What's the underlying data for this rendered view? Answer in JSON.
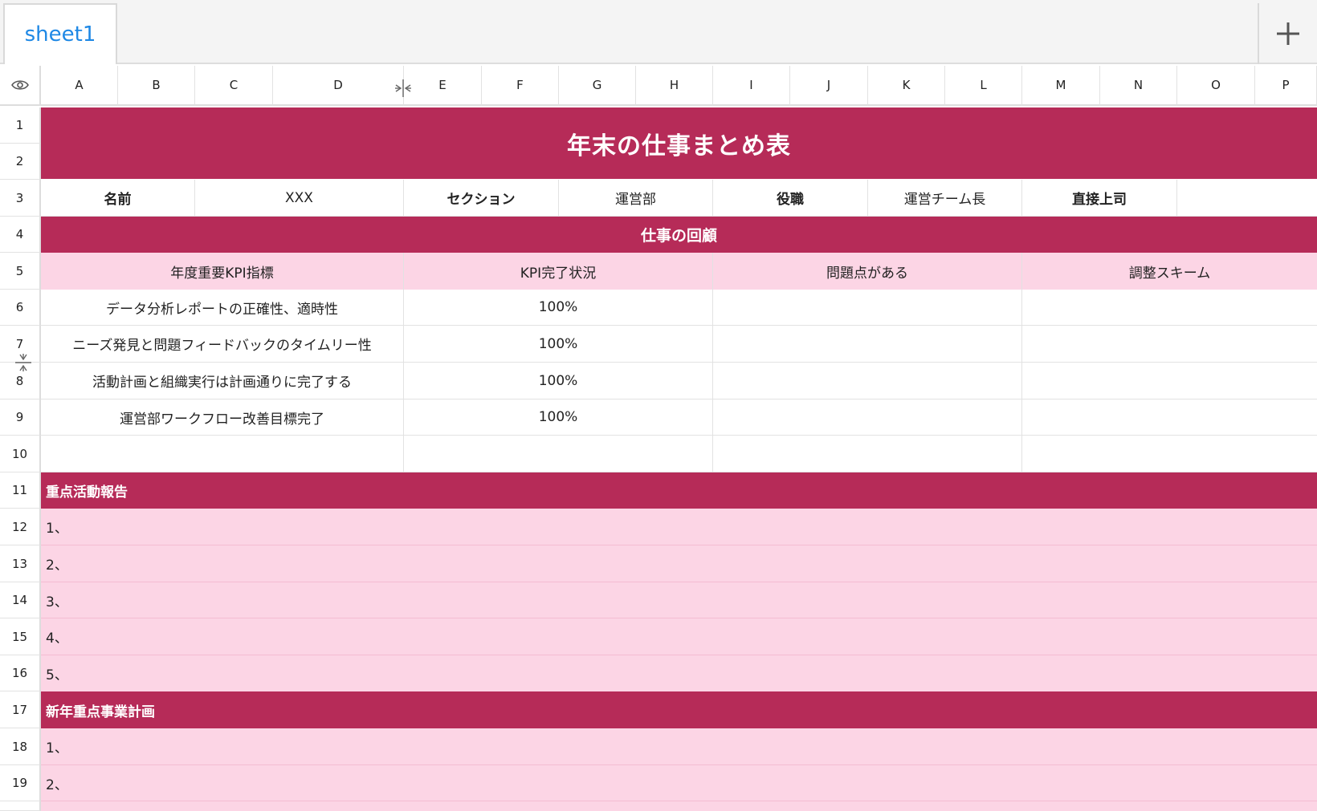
{
  "tabs": [
    {
      "label": "sheet1"
    }
  ],
  "columns": [
    "A",
    "B",
    "C",
    "D",
    "E",
    "F",
    "G",
    "H",
    "I",
    "J",
    "K",
    "L",
    "M",
    "N",
    "O",
    "P"
  ],
  "rows": [
    "1",
    "2",
    "3",
    "4",
    "5",
    "6",
    "7",
    "8",
    "9",
    "10",
    "11",
    "12",
    "13",
    "14",
    "15",
    "16",
    "17",
    "18",
    "19"
  ],
  "icons": {
    "corner": "eye-icon",
    "add": "plus-icon",
    "col_resize": "column-resize-icon",
    "row_resize": "row-resize-icon"
  },
  "colors": {
    "banner": "#b62b58",
    "pink": "#fcd5e5",
    "tab_text": "#1e88e5"
  },
  "sheet": {
    "title": "年末の仕事まとめ表",
    "info": {
      "name_label": "名前",
      "name_value": "XXX",
      "section_label": "セクション",
      "section_value": "運営部",
      "position_label": "役職",
      "position_value": "運営チーム長",
      "boss_label": "直接上司",
      "boss_value": ""
    },
    "review_title": "仕事の回顧",
    "review_headers": [
      "年度重要KPI指標",
      "KPI完了状況",
      "問題点がある",
      "調整スキーム"
    ],
    "review_rows": [
      [
        "データ分析レポートの正確性、適時性",
        "100%",
        "",
        ""
      ],
      [
        "ニーズ発見と問題フィードバックのタイムリー性",
        "100%",
        "",
        ""
      ],
      [
        "活動計画と組織実行は計画通りに完了する",
        "100%",
        "",
        ""
      ],
      [
        "運営部ワークフロー改善目標完了",
        "100%",
        "",
        ""
      ],
      [
        "",
        "",
        "",
        ""
      ]
    ],
    "activity_title": "重点活動報告",
    "activity_items": [
      "1、",
      "2、",
      "3、",
      "4、",
      "5、"
    ],
    "plan_title": "新年重点事業計画",
    "plan_items": [
      "1、",
      "2、"
    ]
  }
}
